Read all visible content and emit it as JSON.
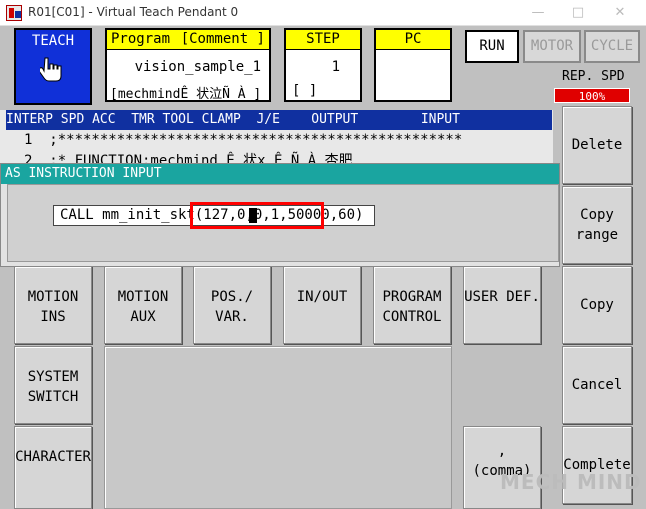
{
  "window": {
    "title": "R01[C01] - Virtual Teach Pendant 0",
    "min_glyph": "—",
    "max_glyph": "□",
    "close_glyph": "✕"
  },
  "header": {
    "teach_label": "TEACH",
    "program_label": "Program",
    "comment_label": "[Comment ]",
    "program_name": "vision_sample_1",
    "program_comment": "[mechmindÊ 状泣Ñ À ]",
    "step_label": "STEP",
    "step_number": "1",
    "step_bracket": "[      ]",
    "pc_label": "PC",
    "run_label": "RUN",
    "motor_label": "MOTOR",
    "cycle_label": "CYCLE",
    "rep_spd_label": "REP. SPD",
    "rep_spd_value": "100%"
  },
  "listing": {
    "columns": "INTERP SPD ACC  TMR TOOL CLAMP  J/E    OUTPUT        INPUT",
    "line1": "1  ;************************************************",
    "line2": "2  ;* FUNCTION:mechmind Ê 状x Ê Ñ À 杏肥"
  },
  "dialog": {
    "title": "AS INSTRUCTION INPUT",
    "instruction_cmd": "CALL mm_init_skt",
    "instruction_args": "(127,0,0,1,50000,60)"
  },
  "commands": {
    "delete": "Delete",
    "copy_range": "Copy\nrange",
    "copy": "Copy",
    "cancel": "Cancel",
    "complete": "Complete"
  },
  "categories": {
    "motion_ins": "MOTION\nINS",
    "motion_aux": "MOTION\nAUX",
    "pos_var": "POS./\nVAR.",
    "inout": "IN/OUT",
    "program_control": "PROGRAM\nCONTROL",
    "user_def": "USER DEF.",
    "system_switch": "SYSTEM\nSWITCH",
    "character": "CHARACTER",
    "comma": ",\n(comma)"
  },
  "watermark": "MECH MIND",
  "colors": {
    "teach_blue": "#1030d8",
    "header_yellow": "#ffff00",
    "listing_header_blue": "#1030a0",
    "dialog_title_teal": "#1aa5a0",
    "speed_red": "#e00000",
    "highlight_red": "#ff0000"
  }
}
